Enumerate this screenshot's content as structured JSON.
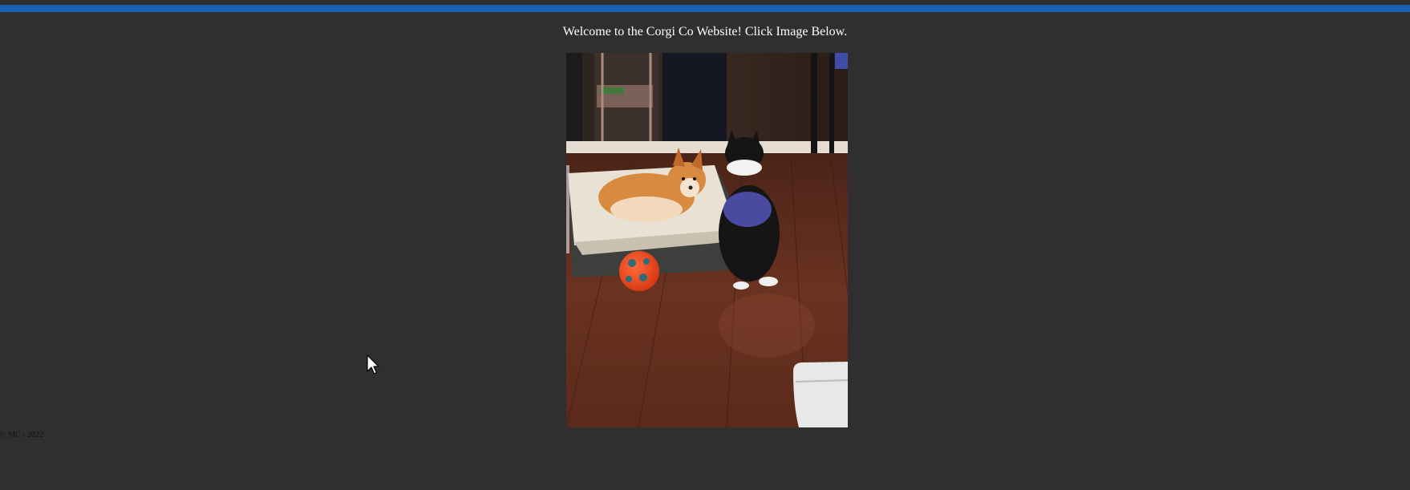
{
  "header": {
    "accent_color": "#1a5fb4"
  },
  "main": {
    "welcome_text": "Welcome to the Corgi Co Website! Click Image Below.",
    "photo": {
      "alt": "Two corgis on a dog bed next to an orange ball on a wooden floor"
    }
  },
  "footer": {
    "copyright": "© MC - 2022"
  },
  "colors": {
    "page_background": "#2f2f2f",
    "text": "#ffffff"
  }
}
